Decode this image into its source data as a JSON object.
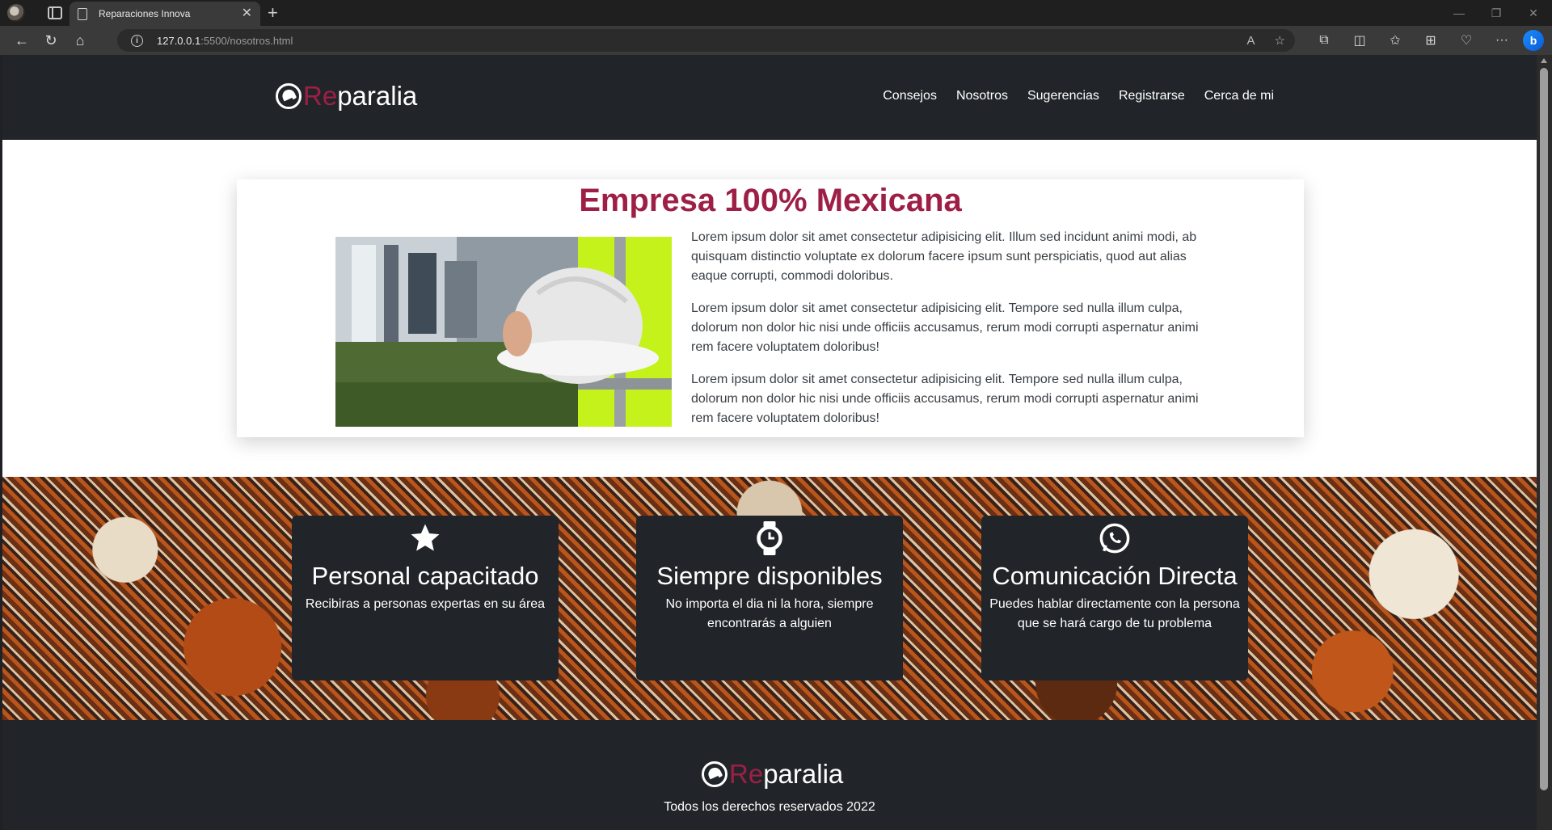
{
  "browser": {
    "tab_title": "Reparaciones Innova",
    "url_host": "127.0.0.1",
    "url_rest": ":5500/nosotros.html",
    "window_controls": [
      "—",
      "❐",
      "✕"
    ]
  },
  "site": {
    "logo_re": "Re",
    "logo_rest": "paralia",
    "nav": [
      "Consejos",
      "Nosotros",
      "Sugerencias",
      "Registrarse",
      "Cerca de mi"
    ]
  },
  "about": {
    "title": "Empresa 100% Mexicana",
    "paragraphs": [
      "Lorem ipsum dolor sit amet consectetur adipisicing elit. Illum sed incidunt animi modi, ab quisquam distinctio voluptate ex dolorum facere ipsum sunt perspiciatis, quod aut alias eaque corrupti, commodi doloribus.",
      "Lorem ipsum dolor sit amet consectetur adipisicing elit. Tempore sed nulla illum culpa, dolorum non dolor hic nisi unde officiis accusamus, rerum modi corrupti aspernatur animi rem facere voluptatem doloribus!",
      "Lorem ipsum dolor sit amet consectetur adipisicing elit. Tempore sed nulla illum culpa, dolorum non dolor hic nisi unde officiis accusamus, rerum modi corrupti aspernatur animi rem facere voluptatem doloribus!"
    ]
  },
  "features": [
    {
      "icon": "star-icon",
      "title": "Personal capacitado",
      "text": "Recibiras a personas expertas en su área"
    },
    {
      "icon": "watch-icon",
      "title": "Siempre disponibles",
      "text": "No importa el dia ni la hora, siempre encontrarás a alguien"
    },
    {
      "icon": "whatsapp-icon",
      "title": "Comunicación Directa",
      "text": "Puedes hablar directamente con la persona que se hará cargo de tu problema"
    }
  ],
  "footer": {
    "copyright": "Todos los derechos reservados 2022"
  },
  "colors": {
    "brand_accent": "#9e1f45",
    "dark": "#212529"
  }
}
